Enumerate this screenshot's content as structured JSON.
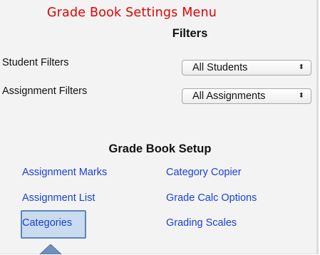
{
  "annotation": {
    "title": "Grade Book Settings Menu",
    "title_color": "#e30000"
  },
  "filters": {
    "heading": "Filters",
    "student": {
      "label": "Student Filters",
      "selected": "All Students"
    },
    "assignment": {
      "label": "Assignment Filters",
      "selected": "All Assignments"
    },
    "dropdown_icon": "updown-chevron-icon"
  },
  "setup": {
    "heading": "Grade Book Setup",
    "link_color": "#1a3fd8",
    "left_links": [
      "Assignment Marks",
      "Assignment List",
      "Categories"
    ],
    "right_links": [
      "Category Copier",
      "Grade Calc Options",
      "Grading Scales"
    ],
    "highlighted": "Categories",
    "highlight_color": "#c9dbee"
  },
  "callout": {
    "icon": "up-arrow-pointer-icon",
    "color": "#6f8fbd"
  }
}
